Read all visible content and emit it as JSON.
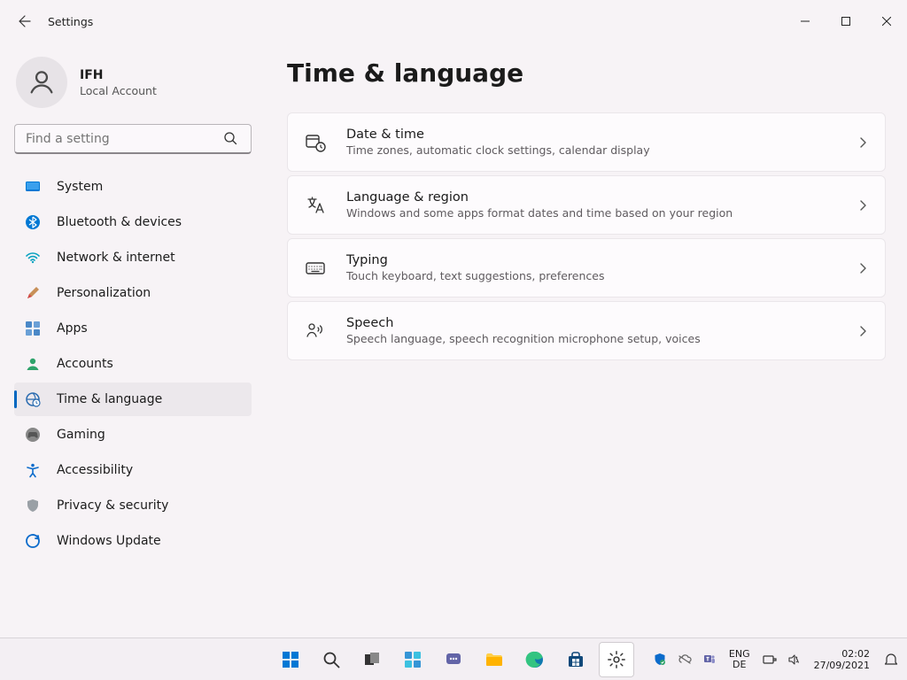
{
  "window": {
    "title": "Settings"
  },
  "user": {
    "name": "IFH",
    "subtitle": "Local Account"
  },
  "search": {
    "placeholder": "Find a setting"
  },
  "nav": {
    "items": [
      {
        "label": "System"
      },
      {
        "label": "Bluetooth & devices"
      },
      {
        "label": "Network & internet"
      },
      {
        "label": "Personalization"
      },
      {
        "label": "Apps"
      },
      {
        "label": "Accounts"
      },
      {
        "label": "Time & language"
      },
      {
        "label": "Gaming"
      },
      {
        "label": "Accessibility"
      },
      {
        "label": "Privacy & security"
      },
      {
        "label": "Windows Update"
      }
    ],
    "selected_index": 6
  },
  "page": {
    "heading": "Time & language",
    "cards": [
      {
        "title": "Date & time",
        "subtitle": "Time zones, automatic clock settings, calendar display"
      },
      {
        "title": "Language & region",
        "subtitle": "Windows and some apps format dates and time based on your region"
      },
      {
        "title": "Typing",
        "subtitle": "Touch keyboard, text suggestions, preferences"
      },
      {
        "title": "Speech",
        "subtitle": "Speech language, speech recognition microphone setup, voices"
      }
    ]
  },
  "taskbar": {
    "lang_top": "ENG",
    "lang_bottom": "DE",
    "clock_time": "02:02",
    "clock_date": "27/09/2021"
  }
}
